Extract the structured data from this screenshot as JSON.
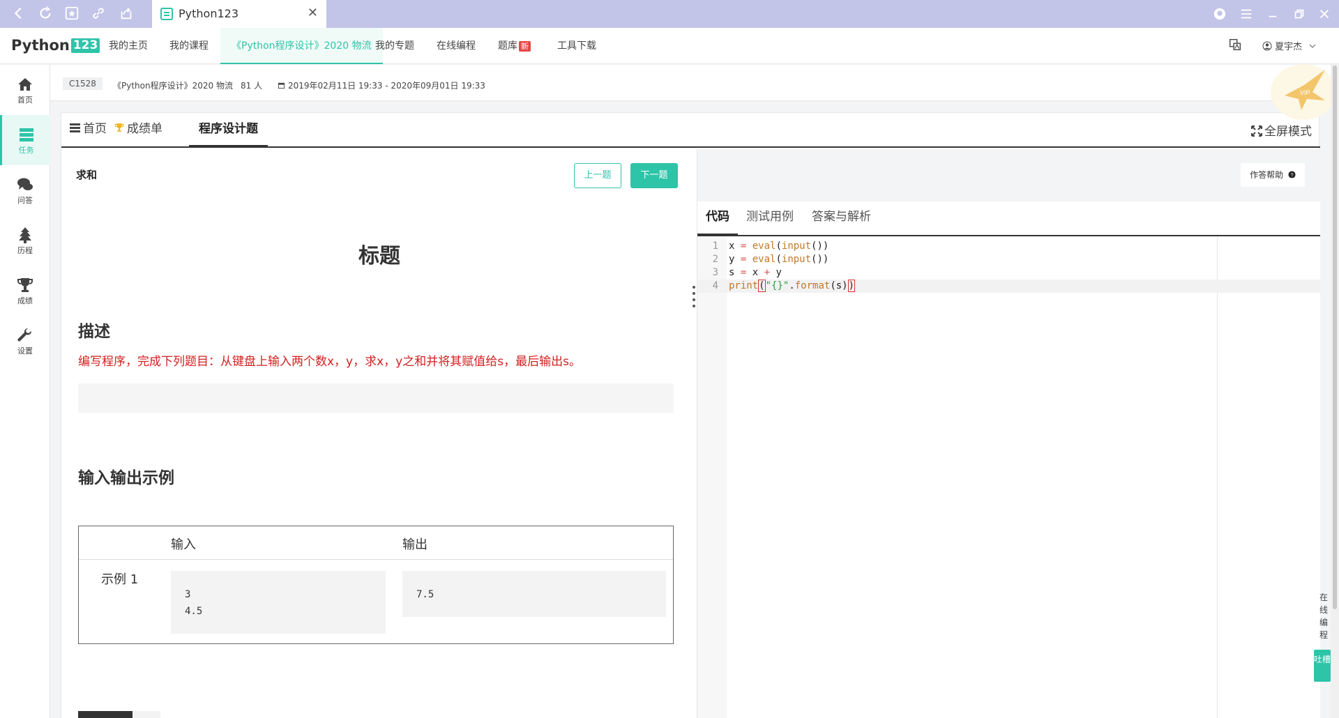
{
  "browser": {
    "tab_title": "Python123",
    "tab_close": "✕"
  },
  "site": {
    "logo_text": "Python",
    "logo_badge": "123",
    "nav": [
      {
        "label": "我的主页"
      },
      {
        "label": "我的课程"
      },
      {
        "label": "《Python程序设计》2020 物流"
      },
      {
        "label": "我的专题"
      },
      {
        "label": "在线编程"
      },
      {
        "label": "题库",
        "badge": "新"
      },
      {
        "label": "工具下载"
      }
    ],
    "user_name": "夏宇杰"
  },
  "sidebar": [
    {
      "label": "首页",
      "icon": "home-icon"
    },
    {
      "label": "任务",
      "icon": "tasks-icon"
    },
    {
      "label": "问答",
      "icon": "comments-icon"
    },
    {
      "label": "历程",
      "icon": "tree-icon"
    },
    {
      "label": "成绩",
      "icon": "trophy-icon"
    },
    {
      "label": "设置",
      "icon": "wrench-icon"
    }
  ],
  "course": {
    "code": "C1528",
    "name": "《Python程序设计》2020 物流",
    "members": "81 人",
    "period": "2019年02月11日 19:33 - 2020年09月01日 19:33"
  },
  "page_tabs": [
    {
      "label": "首页",
      "icon": "list-icon"
    },
    {
      "label": "成绩单",
      "icon": "trophy-icon"
    },
    {
      "label": "程序设计题"
    }
  ],
  "fullscreen_label": "全屏模式",
  "problem": {
    "name": "求和",
    "prev_label": "上一题",
    "next_label": "下一题",
    "title": "标题",
    "desc_heading": "描述",
    "description": "编写程序，完成下列题目：从键盘上输入两个数x，y，求x，y之和并将其赋值给s，最后输出s。",
    "io_heading": "输入输出示例",
    "io_col_input": "输入",
    "io_col_output": "输出",
    "example_label": "示例 1",
    "example_input": "3\n4.5",
    "example_output": "7.5"
  },
  "code": {
    "help_label": "作答帮助",
    "tabs": [
      "代码",
      "测试用例",
      "答案与解析"
    ],
    "line_numbers": [
      "1",
      "2",
      "3",
      "4"
    ]
  },
  "floating": {
    "side_text": "在线编程",
    "button_text": "吐槽"
  },
  "colors": {
    "accent": "#2ec4a8",
    "browser_bar": "#c2c4e8",
    "description_red": "#d32020"
  }
}
